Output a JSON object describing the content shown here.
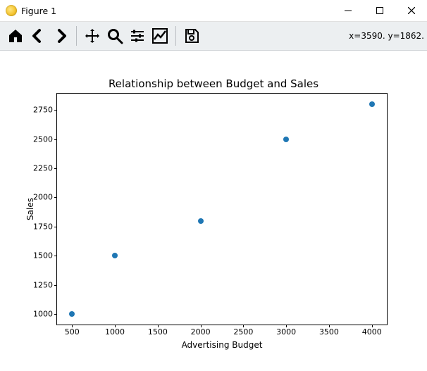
{
  "window": {
    "title": "Figure 1"
  },
  "toolbar": {
    "coords": "x=3590. y=1862."
  },
  "chart_data": {
    "type": "scatter",
    "title": "Relationship between Budget and Sales",
    "xlabel": "Advertising Budget",
    "ylabel": "Sales",
    "x": [
      500,
      1000,
      2000,
      3000,
      4000
    ],
    "y": [
      1000,
      1500,
      1800,
      2500,
      2800
    ],
    "xticks": [
      500,
      1000,
      1500,
      2000,
      2500,
      3000,
      3500,
      4000
    ],
    "yticks": [
      1000,
      1250,
      1500,
      1750,
      2000,
      2250,
      2500,
      2750
    ],
    "xlim": [
      325,
      4175
    ],
    "ylim": [
      910,
      2890
    ]
  }
}
